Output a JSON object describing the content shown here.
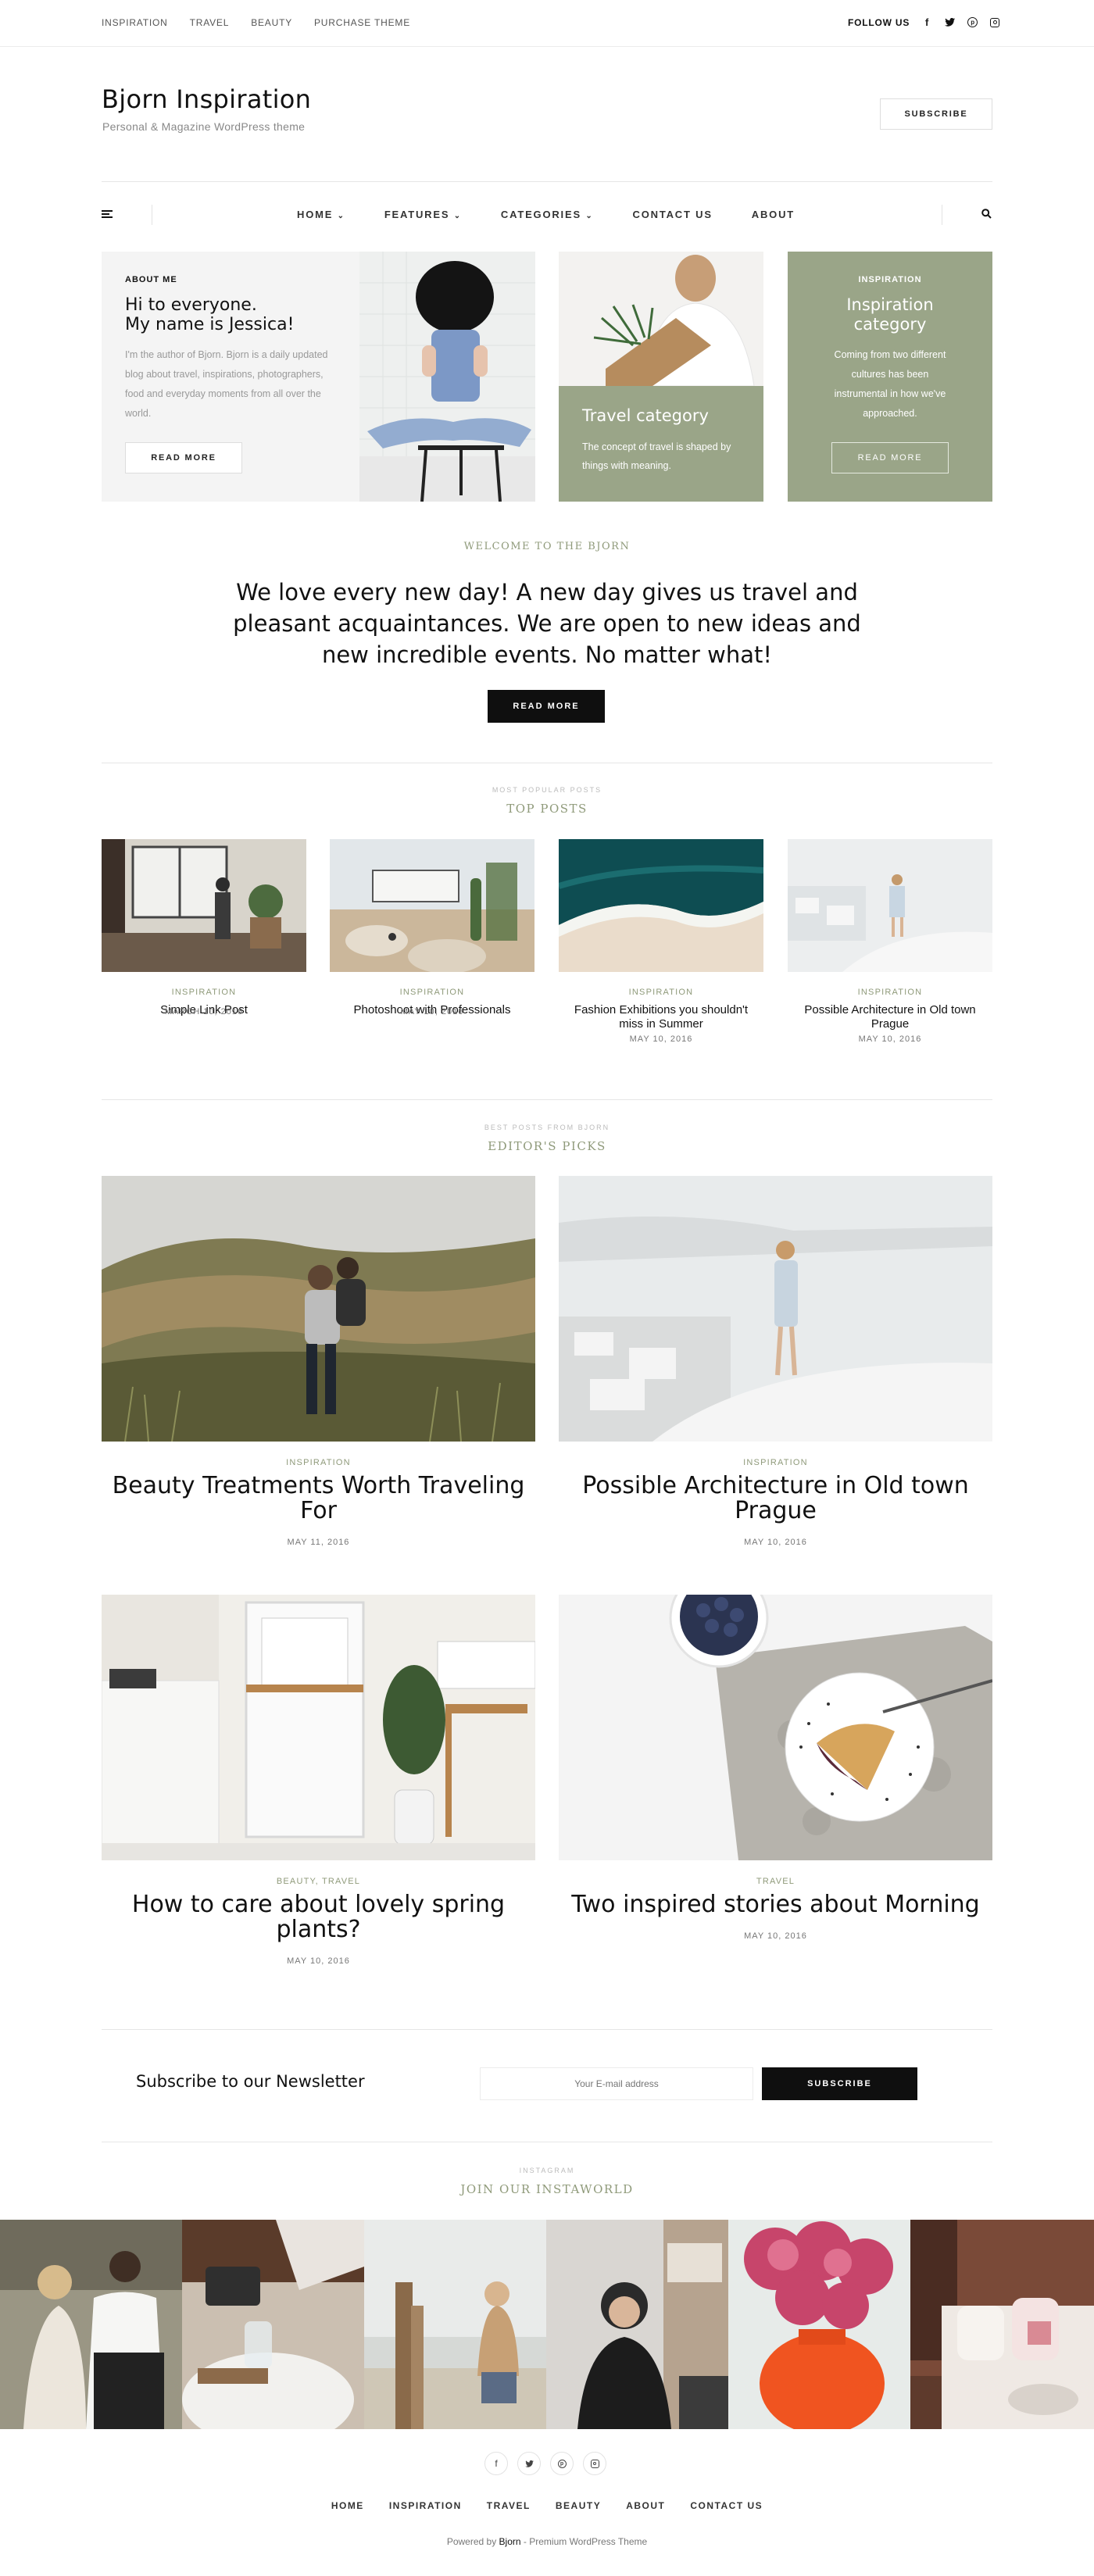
{
  "topbar": {
    "nav": [
      "INSPIRATION",
      "TRAVEL",
      "BEAUTY",
      "PURCHASE THEME"
    ],
    "follow_label": "FOLLOW US",
    "social_icons": [
      "facebook-icon",
      "twitter-icon",
      "pinterest-icon",
      "instagram-icon"
    ],
    "social_glyphs": [
      "f",
      "t",
      "p",
      "◎"
    ]
  },
  "header": {
    "site_title": "Bjorn Inspiration",
    "tagline": "Personal & Magazine WordPress theme",
    "subscribe_label": "SUBSCRIBE"
  },
  "mainnav": {
    "items": [
      "HOME",
      "FEATURES",
      "CATEGORIES",
      "CONTACT US",
      "ABOUT"
    ],
    "dropdown_marker": "⌄"
  },
  "promo": {
    "about": {
      "kicker": "ABOUT ME",
      "heading_line1": "Hi to everyone.",
      "heading_line2": "My name is Jessica!",
      "text": "I'm the author of Bjorn. Bjorn is a daily updated blog about travel, inspirations, photographers, food and everyday moments from all over the world.",
      "button": "READ MORE"
    },
    "travel": {
      "title": "Travel category",
      "text": "The concept of travel is shaped by things with meaning."
    },
    "inspiration": {
      "kicker": "INSPIRATION",
      "title_line1": "Inspiration",
      "title_line2": "category",
      "text": "Coming from two different cultures has been instrumental in how we've approached.",
      "button": "READ MORE"
    }
  },
  "welcome": {
    "kicker": "WELCOME TO THE BJORN",
    "line1": "We love every new day! A new day gives us travel and",
    "line2": "pleasant acquaintances. We are open to new ideas and",
    "line3": "new incredible events. No matter what!",
    "button": "READ MORE"
  },
  "top_posts": {
    "kicker": "MOST POPULAR POSTS",
    "title": "TOP POSTS",
    "posts": [
      {
        "category": "INSPIRATION",
        "title": "Simple Link Post",
        "title2": "",
        "date": "MARCH 10, 2016"
      },
      {
        "category": "INSPIRATION",
        "title": "Photoshoot with Professionals",
        "title2": "",
        "date": "MAY 10, 2016"
      },
      {
        "category": "INSPIRATION",
        "title": "Fashion Exhibitions you shouldn't",
        "title2": "miss in Summer",
        "date": "MAY 10, 2016"
      },
      {
        "category": "INSPIRATION",
        "title": "Possible Architecture in Old town",
        "title2": "Prague",
        "date": "MAY 10, 2016"
      }
    ]
  },
  "editors": {
    "kicker": "BEST POSTS FROM BJORN",
    "title": "EDITOR'S PICKS",
    "posts": [
      {
        "category": "INSPIRATION",
        "title": "Beauty Treatments Worth Traveling",
        "title2": "For",
        "date": "MAY 11, 2016"
      },
      {
        "category": "INSPIRATION",
        "title": "Possible Architecture in Old town",
        "title2": "Prague",
        "date": "MAY 10, 2016"
      },
      {
        "category": "BEAUTY, TRAVEL",
        "title": "How to care about lovely spring",
        "title2": "plants?",
        "date": "MAY 10, 2016"
      },
      {
        "category": "TRAVEL",
        "title": "Two inspired stories about Morning",
        "title2": "",
        "date": "MAY 10, 2016"
      }
    ]
  },
  "newsletter": {
    "title": "Subscribe to our Newsletter",
    "placeholder": "Your E-mail address",
    "button": "SUBSCRIBE"
  },
  "instagram": {
    "kicker": "INSTAGRAM",
    "title": "JOIN OUR INSTAWORLD"
  },
  "footer": {
    "social_icons": [
      "facebook-icon",
      "twitter-icon",
      "pinterest-icon",
      "instagram-icon"
    ],
    "social_glyphs": [
      "f",
      "t",
      "p",
      "◎"
    ],
    "nav": [
      "HOME",
      "INSPIRATION",
      "TRAVEL",
      "BEAUTY",
      "ABOUT",
      "CONTACT US"
    ],
    "powered_prefix": "Powered by",
    "powered_brand": "Bjorn",
    "powered_suffix": "- Premium WordPress Theme"
  },
  "colors": {
    "accent_green": "#9aa588",
    "text_dark": "#222222",
    "button_black": "#0f0f0f"
  }
}
